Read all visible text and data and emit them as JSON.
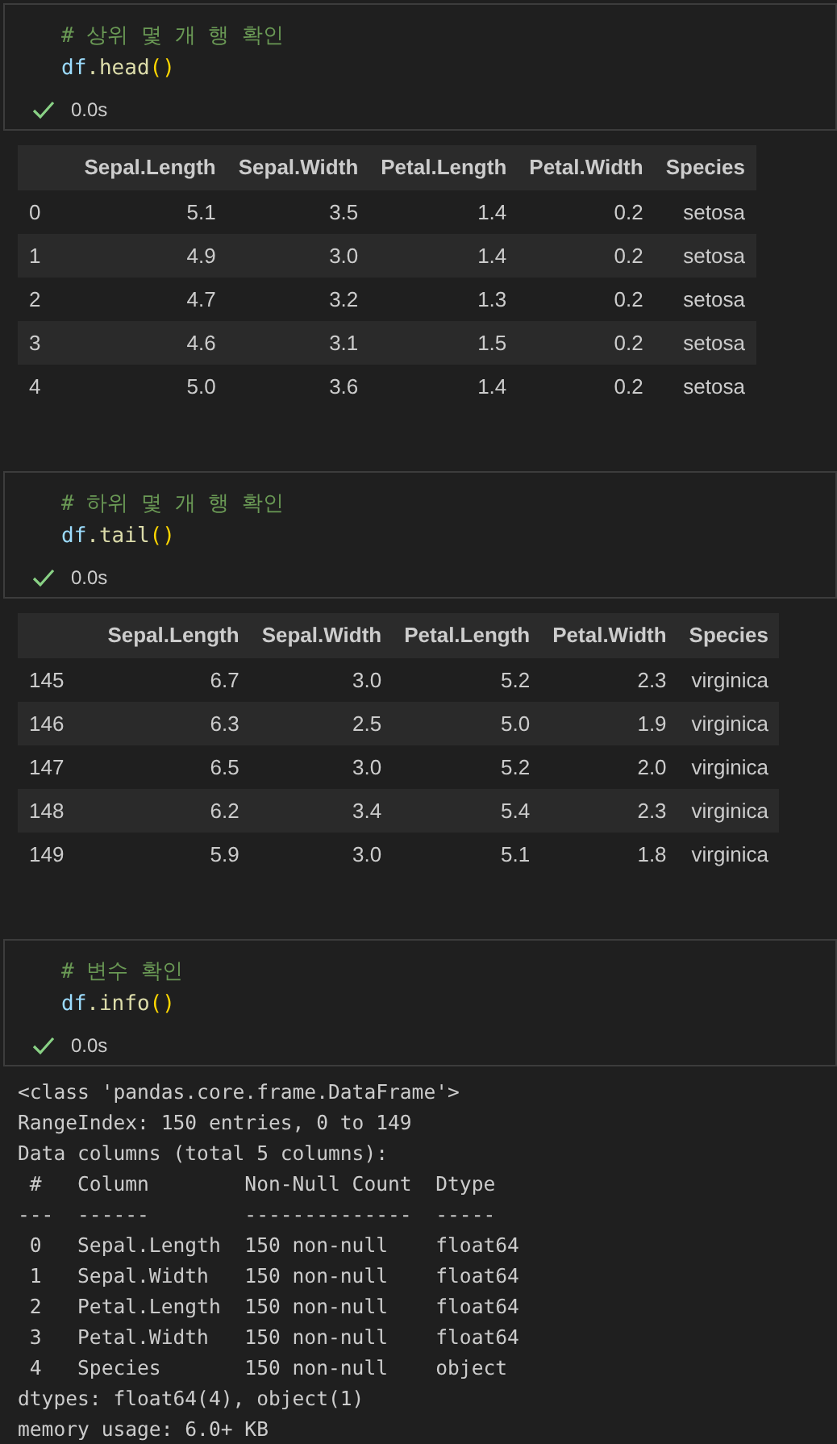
{
  "cells": [
    {
      "comment": "# 상위 몇 개 행 확인",
      "code": [
        {
          "kind": "variable",
          "text": "df"
        },
        {
          "kind": "function",
          "text": ".head"
        },
        {
          "kind": "bracket",
          "text": "()"
        }
      ],
      "succeeded": true,
      "time": "0.0s",
      "output": {
        "kind": "table",
        "columns": [
          "",
          "Sepal.Length",
          "Sepal.Width",
          "Petal.Length",
          "Petal.Width",
          "Species"
        ],
        "rows": [
          [
            "0",
            "5.1",
            "3.5",
            "1.4",
            "0.2",
            "setosa"
          ],
          [
            "1",
            "4.9",
            "3.0",
            "1.4",
            "0.2",
            "setosa"
          ],
          [
            "2",
            "4.7",
            "3.2",
            "1.3",
            "0.2",
            "setosa"
          ],
          [
            "3",
            "4.6",
            "3.1",
            "1.5",
            "0.2",
            "setosa"
          ],
          [
            "4",
            "5.0",
            "3.6",
            "1.4",
            "0.2",
            "setosa"
          ]
        ]
      }
    },
    {
      "comment": "# 하위 몇 개 행 확인",
      "code": [
        {
          "kind": "variable",
          "text": "df"
        },
        {
          "kind": "function",
          "text": ".tail"
        },
        {
          "kind": "bracket",
          "text": "()"
        }
      ],
      "succeeded": true,
      "time": "0.0s",
      "output": {
        "kind": "table",
        "columns": [
          "",
          "Sepal.Length",
          "Sepal.Width",
          "Petal.Length",
          "Petal.Width",
          "Species"
        ],
        "rows": [
          [
            "145",
            "6.7",
            "3.0",
            "5.2",
            "2.3",
            "virginica"
          ],
          [
            "146",
            "6.3",
            "2.5",
            "5.0",
            "1.9",
            "virginica"
          ],
          [
            "147",
            "6.5",
            "3.0",
            "5.2",
            "2.0",
            "virginica"
          ],
          [
            "148",
            "6.2",
            "3.4",
            "5.4",
            "2.3",
            "virginica"
          ],
          [
            "149",
            "5.9",
            "3.0",
            "5.1",
            "1.8",
            "virginica"
          ]
        ]
      }
    },
    {
      "comment": "# 변수 확인",
      "code": [
        {
          "kind": "variable",
          "text": "df"
        },
        {
          "kind": "function",
          "text": ".info"
        },
        {
          "kind": "bracket",
          "text": "()"
        }
      ],
      "succeeded": true,
      "time": "0.0s",
      "output": {
        "kind": "text",
        "lines": [
          "<class 'pandas.core.frame.DataFrame'>",
          "RangeIndex: 150 entries, 0 to 149",
          "Data columns (total 5 columns):",
          " #   Column        Non-Null Count  Dtype",
          "---  ------        --------------  -----",
          " 0   Sepal.Length  150 non-null    float64",
          " 1   Sepal.Width   150 non-null    float64",
          " 2   Petal.Length  150 non-null    float64",
          " 3   Petal.Width   150 non-null    float64",
          " 4   Species       150 non-null    object",
          "dtypes: float64(4), object(1)",
          "memory usage: 6.0+ KB"
        ]
      }
    }
  ]
}
